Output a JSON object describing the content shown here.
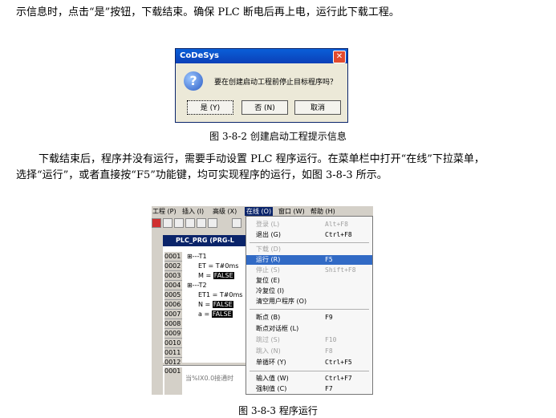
{
  "paragraph_top": "示信息时，点击“是”按钮，下载结束。确保 PLC 断电后再上电，运行此下载工程。",
  "dialog": {
    "title": "CoDeSys",
    "close": "✕",
    "icon_glyph": "?",
    "message": "要在创建启动工程前停止目标程序吗？",
    "buttons": [
      "是 (Y)",
      "否 (N)",
      "取消"
    ]
  },
  "caption1": "图 3-8-2  创建启动工程提示信息",
  "paragraph_mid": [
    "下载结束后，程序并没有运行，需要手动设置 PLC 程序运行。在菜单栏中打开“在线”下拉菜单，",
    "选择“运行”，或者直接按“F5”功能键，均可实现程序的运行，如图 3-8-3 所示。"
  ],
  "codesys": {
    "menubar": [
      "工程 (P)",
      "插入 (I)",
      "高级 (X)",
      "在线 (O)",
      "窗口 (W)",
      "帮助 (H)"
    ],
    "prg_title": "PLC_PRG  (PRG-L",
    "line_numbers": [
      "0001",
      "0002",
      "0003",
      "0004",
      "0005",
      "0006",
      "0007",
      "0008",
      "0009",
      "0010",
      "0011",
      "0012"
    ],
    "code": [
      {
        "text": "⊞---T1",
        "hl": ""
      },
      {
        "text": "ET = T#0ms",
        "hl": ""
      },
      {
        "text": "M = ",
        "hl": "FALSE"
      },
      {
        "text": "⊞---T2",
        "hl": ""
      },
      {
        "text": "ET1 = T#0ms",
        "hl": ""
      },
      {
        "text": "N = ",
        "hl": "FALSE"
      },
      {
        "text": "a = ",
        "hl": "FALSE"
      }
    ],
    "lower_line": "0001",
    "lower_text": "当%IX0.0接通时",
    "menu_items": [
      {
        "label": "登录 (L)",
        "shortcut": "Alt+F8",
        "state": "disabled"
      },
      {
        "label": "退出 (G)",
        "shortcut": "Ctrl+F8",
        "state": "normal"
      },
      {
        "label": "下载 (D)",
        "shortcut": "",
        "state": "disabled"
      },
      {
        "label": "运行 (R)",
        "shortcut": "F5",
        "state": "selected"
      },
      {
        "label": "停止 (S)",
        "shortcut": "Shift+F8",
        "state": "disabled"
      },
      {
        "label": "复位 (E)",
        "shortcut": "",
        "state": "normal"
      },
      {
        "label": "冷复位 (I)",
        "shortcut": "",
        "state": "normal"
      },
      {
        "label": "清空用户程序 (O)",
        "shortcut": "",
        "state": "normal"
      },
      {
        "label": "断点 (B)",
        "shortcut": "F9",
        "state": "normal"
      },
      {
        "label": "断点对话框 (L)",
        "shortcut": "",
        "state": "normal"
      },
      {
        "label": "跳过 (S)",
        "shortcut": "F10",
        "state": "disabled"
      },
      {
        "label": "跳入 (N)",
        "shortcut": "F8",
        "state": "disabled"
      },
      {
        "label": "单循环 (Y)",
        "shortcut": "Ctrl+F5",
        "state": "normal"
      },
      {
        "label": "输入值 (W)",
        "shortcut": "Ctrl+F7",
        "state": "normal"
      },
      {
        "label": "强制值 (C)",
        "shortcut": "F7",
        "state": "normal"
      }
    ]
  },
  "caption2": "图 3-8-3  程序运行"
}
